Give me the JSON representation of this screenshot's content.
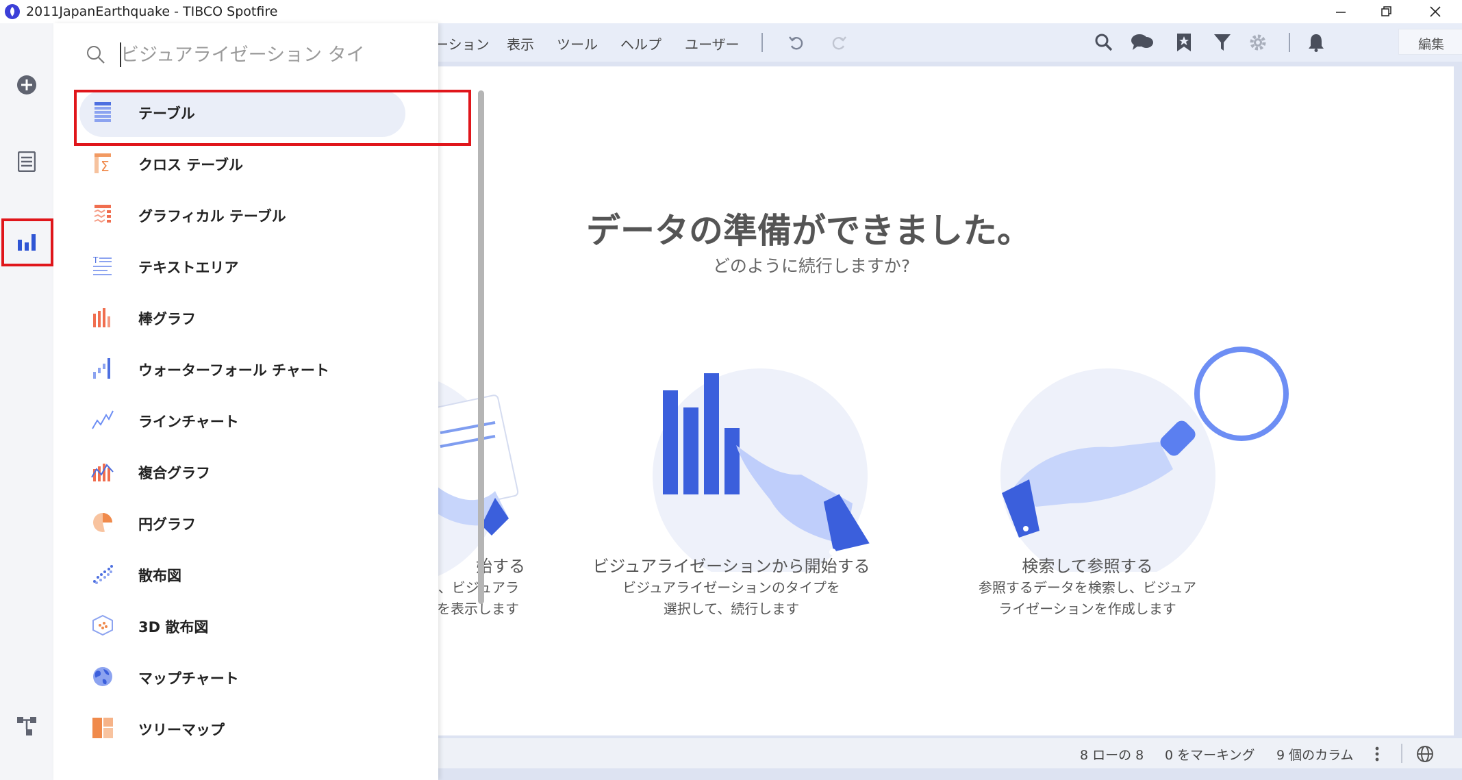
{
  "window": {
    "title": "2011JapanEarthquake - TIBCO Spotfire",
    "minimize_glyph": "—",
    "maximize_glyph": "❐",
    "close_glyph": "✕"
  },
  "menubar": {
    "items": [
      "ーション",
      "表示",
      "ツール",
      "ヘルプ",
      "ユーザー"
    ],
    "mode": "編集"
  },
  "search": {
    "placeholder": "ビジュアライゼーション タイ"
  },
  "visualizations": [
    {
      "label": "テーブル",
      "icon": "table-icon",
      "selected": true
    },
    {
      "label": "クロス テーブル",
      "icon": "cross-table-icon"
    },
    {
      "label": "グラフィカル テーブル",
      "icon": "graphical-table-icon"
    },
    {
      "label": "テキストエリア",
      "icon": "text-area-icon"
    },
    {
      "label": "棒グラフ",
      "icon": "bar-chart-icon"
    },
    {
      "label": "ウォーターフォール チャート",
      "icon": "waterfall-chart-icon"
    },
    {
      "label": "ラインチャート",
      "icon": "line-chart-icon"
    },
    {
      "label": "複合グラフ",
      "icon": "combination-chart-icon"
    },
    {
      "label": "円グラフ",
      "icon": "pie-chart-icon"
    },
    {
      "label": "散布図",
      "icon": "scatter-plot-icon"
    },
    {
      "label": "3D 散布図",
      "icon": "3d-scatter-plot-icon"
    },
    {
      "label": "マップチャート",
      "icon": "map-chart-icon"
    },
    {
      "label": "ツリーマップ",
      "icon": "treemap-icon"
    }
  ],
  "hero": {
    "title": "データの準備ができました。",
    "subtitle": "どのように続行しますか?"
  },
  "cards": [
    {
      "title": "始する",
      "desc1": "、ビジュアラ",
      "desc2": "を表示します"
    },
    {
      "title": "ビジュアライゼーションから開始する",
      "desc1": "ビジュアライゼーションのタイプを",
      "desc2": "選択して、続行します"
    },
    {
      "title": "検索して参照する",
      "desc1": "参照するデータを検索し、ビジュア",
      "desc2": "ライゼーションを作成します"
    }
  ],
  "status": {
    "rows": "8 ローの 8",
    "marked": "0 をマーキング",
    "columns": "9 個のカラム"
  },
  "colors": {
    "accent": "#2f55d4",
    "selection_frame": "#e0161b",
    "menubar_bg": "#e8edf8"
  }
}
